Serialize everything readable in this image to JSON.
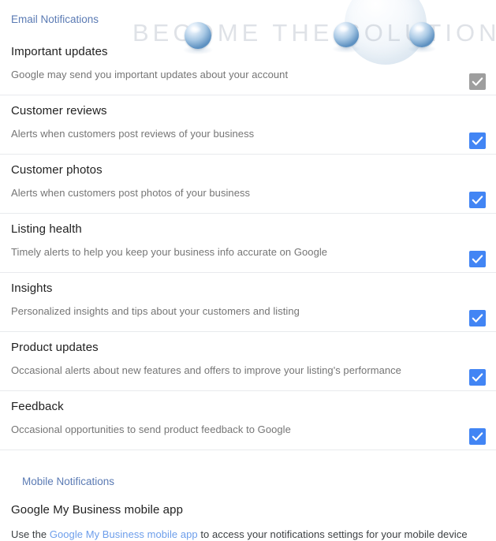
{
  "watermark": {
    "text": "BECOME THE SOLUTION",
    "color": "#96a0af"
  },
  "email_section": {
    "header": "Email Notifications",
    "rows": [
      {
        "title": "Important updates",
        "description": "Google may send you important updates about your account",
        "checkbox": {
          "checked": true,
          "enabled": false,
          "color": "#9e9e9e"
        }
      },
      {
        "title": "Customer reviews",
        "description": "Alerts when customers post reviews of your business",
        "checkbox": {
          "checked": true,
          "enabled": true,
          "color": "#4285f4"
        }
      },
      {
        "title": "Customer photos",
        "description": "Alerts when customers post photos of your business",
        "checkbox": {
          "checked": true,
          "enabled": true,
          "color": "#4285f4"
        }
      },
      {
        "title": "Listing health",
        "description": "Timely alerts to help you keep your business info accurate on Google",
        "checkbox": {
          "checked": true,
          "enabled": true,
          "color": "#4285f4"
        }
      },
      {
        "title": "Insights",
        "description": "Personalized insights and tips about your customers and listing",
        "checkbox": {
          "checked": true,
          "enabled": true,
          "color": "#4285f4"
        }
      },
      {
        "title": "Product updates",
        "description": "Occasional alerts about new features and offers to improve your listing's performance",
        "checkbox": {
          "checked": true,
          "enabled": true,
          "color": "#4285f4"
        }
      },
      {
        "title": "Feedback",
        "description": "Occasional opportunities to send product feedback to Google",
        "checkbox": {
          "checked": true,
          "enabled": true,
          "color": "#4285f4"
        }
      }
    ]
  },
  "mobile_section": {
    "header": "Mobile Notifications",
    "title": "Google My Business mobile app",
    "desc_prefix": "Use the ",
    "link_text": "Google My Business mobile app",
    "desc_suffix": " to access your notifications settings for your mobile device"
  },
  "colors": {
    "accent": "#4285f4",
    "section_header": "#5b7bb4",
    "link": "#6d9eeb",
    "divider": "#e8eaed",
    "title_text": "#212121",
    "desc_text": "#757575"
  }
}
